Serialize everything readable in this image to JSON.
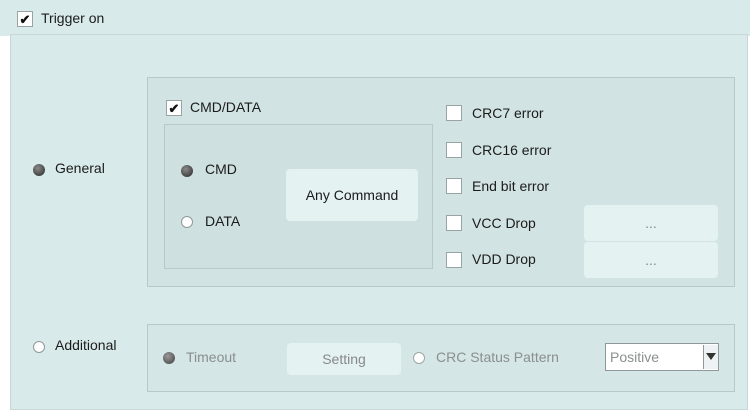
{
  "trigger": {
    "label": "Trigger on",
    "checked": true
  },
  "general": {
    "label": "General",
    "selected": true,
    "cmd_data": {
      "label": "CMD/DATA",
      "checked": true
    },
    "cmd": {
      "label": "CMD",
      "selected": true
    },
    "data": {
      "label": "DATA",
      "selected": false
    },
    "any_command_label": "Any Command",
    "errors": [
      {
        "label": "CRC7 error",
        "checked": false
      },
      {
        "label": "CRC16 error",
        "checked": false
      },
      {
        "label": "End bit error",
        "checked": false
      },
      {
        "label": "VCC Drop",
        "checked": false
      },
      {
        "label": "VDD Drop",
        "checked": false
      }
    ],
    "ellipsis_label": "..."
  },
  "additional": {
    "label": "Additional",
    "selected": false,
    "timeout": {
      "label": "Timeout",
      "selected": true
    },
    "setting_label": "Setting",
    "crc_status": {
      "label": "CRC Status Pattern",
      "selected": false
    },
    "select_value": "Positive"
  }
}
